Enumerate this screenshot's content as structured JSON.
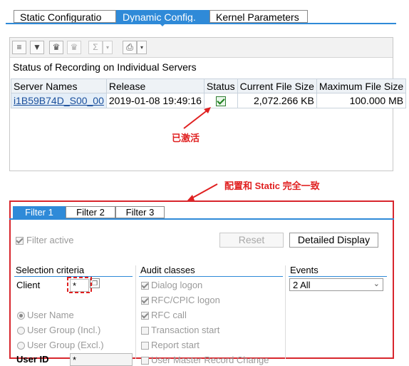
{
  "tabs": [
    "Static Configuratio",
    "Dynamic Config.",
    "Kernel Parameters"
  ],
  "panel": {
    "title": "Status of Recording on Individual Servers",
    "toolbar_icons": [
      "align-top-icon",
      "filter-icon",
      "find-icon",
      "find-next-icon",
      "sum-icon",
      "export-icon"
    ],
    "columns": [
      "Server Names",
      "Release",
      "Status",
      "Current File Size",
      "Maximum File Size"
    ],
    "rows": [
      {
        "server": "i1B59B74D_S00_00",
        "release": "2019-01-08 19:49:16",
        "status": "active",
        "current": "2,072.266 KB",
        "maximum": "100.000 MB"
      }
    ]
  },
  "annotations": {
    "activated": "已激活",
    "matches_static": "配置和 Static 完全一致"
  },
  "filter_tabs": [
    "Filter 1",
    "Filter 2",
    "Filter 3"
  ],
  "filter": {
    "active_label": "Filter active",
    "reset_label": "Reset",
    "detail_label": "Detailed Display",
    "selection": {
      "title": "Selection criteria",
      "client_label": "Client",
      "client_value": "*",
      "options": [
        "User Name",
        "User Group (Incl.)",
        "User Group (Excl.)"
      ],
      "user_id_label": "User ID",
      "user_id_value": "*"
    },
    "audit": {
      "title": "Audit classes",
      "items": [
        {
          "label": "Dialog logon",
          "checked": true
        },
        {
          "label": "RFC/CPIC logon",
          "checked": true
        },
        {
          "label": "RFC call",
          "checked": true
        },
        {
          "label": "Transaction start",
          "checked": false
        },
        {
          "label": "Report start",
          "checked": false
        },
        {
          "label": "User Master Record Change",
          "checked": false
        }
      ]
    },
    "events": {
      "title": "Events",
      "value": "2 All"
    }
  },
  "colors": {
    "accent": "#2f8ad8",
    "annotation": "#e02020"
  }
}
